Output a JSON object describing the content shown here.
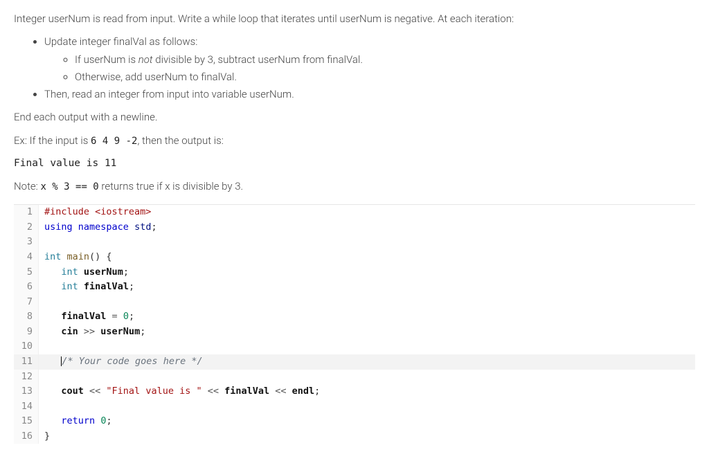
{
  "prompt": {
    "intro": "Integer userNum is read from input. Write a while loop that iterates until userNum is negative. At each iteration:",
    "bullets_level1": {
      "b1": "Update integer finalVal as follows:",
      "b2": "Then, read an integer from input into variable userNum."
    },
    "bullets_level2": {
      "s1_prefix": "If userNum is ",
      "s1_em": "not",
      "s1_suffix": " divisible by 3, subtract userNum from finalVal.",
      "s2": "Otherwise, add userNum to finalVal."
    },
    "end_note": "End each output with a newline.",
    "ex_prefix": "Ex: If the input is ",
    "ex_input": "6 4 9 -2",
    "ex_suffix": ", then the output is:",
    "output_line": "Final value is 11",
    "note_prefix": "Note: ",
    "note_code": "x % 3 == 0",
    "note_suffix": " returns true if x is divisible by 3."
  },
  "code": {
    "lines": {
      "l1": {
        "n": "1",
        "pp": "#include",
        "inc": " <iostream>"
      },
      "l2": {
        "n": "2",
        "kw1": "using",
        "kw2": "namespace",
        "ns": "std",
        "semi": ";"
      },
      "l3": {
        "n": "3",
        "txt": ""
      },
      "l4": {
        "n": "4",
        "ty": "int",
        "fn": "main",
        "rest": "() {"
      },
      "l5": {
        "n": "5",
        "indent": "   ",
        "ty": "int",
        "id": "userNum",
        "semi": ";"
      },
      "l6": {
        "n": "6",
        "indent": "   ",
        "ty": "int",
        "id": "finalVal",
        "semi": ";"
      },
      "l7": {
        "n": "7",
        "txt": ""
      },
      "l8": {
        "n": "8",
        "indent": "   ",
        "id": "finalVal",
        "op": " = ",
        "num": "0",
        "semi": ";"
      },
      "l9": {
        "n": "9",
        "indent": "   ",
        "id1": "cin",
        "op": " >> ",
        "id2": "userNum",
        "semi": ";"
      },
      "l10": {
        "n": "10",
        "txt": ""
      },
      "l11": {
        "n": "11",
        "indent": "   ",
        "cmt": "/* Your code goes here */"
      },
      "l12": {
        "n": "12",
        "txt": ""
      },
      "l13": {
        "n": "13",
        "indent": "   ",
        "id1": "cout",
        "op1": " << ",
        "str": "\"Final value is \"",
        "op2": " << ",
        "id2": "finalVal",
        "op3": " << ",
        "id3": "endl",
        "semi": ";"
      },
      "l14": {
        "n": "14",
        "txt": ""
      },
      "l15": {
        "n": "15",
        "indent": "   ",
        "kw": "return",
        "sp": " ",
        "num": "0",
        "semi": ";"
      },
      "l16": {
        "n": "16",
        "txt": "}"
      }
    }
  }
}
